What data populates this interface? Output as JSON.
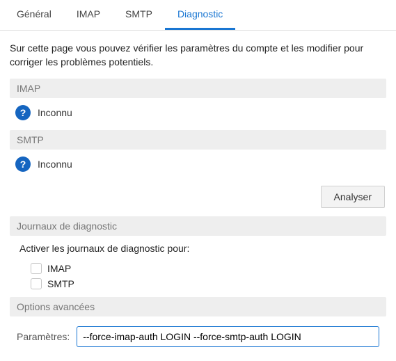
{
  "tabs": {
    "general": "Général",
    "imap": "IMAP",
    "smtp": "SMTP",
    "diagnostic": "Diagnostic"
  },
  "intro": "Sur cette page vous pouvez vérifier les paramètres du compte et les modifier pour corriger les problèmes potentiels.",
  "imap": {
    "header": "IMAP",
    "status": "Inconnu"
  },
  "smtp": {
    "header": "SMTP",
    "status": "Inconnu"
  },
  "analyze_button": "Analyser",
  "logs": {
    "header": "Journaux de diagnostic",
    "enable_label": "Activer les journaux de diagnostic pour:",
    "imap_label": "IMAP",
    "smtp_label": "SMTP"
  },
  "advanced": {
    "header": "Options avancées",
    "params_label": "Paramètres:",
    "params_value": "--force-imap-auth LOGIN --force-smtp-auth LOGIN"
  },
  "icons": {
    "question": "?"
  }
}
